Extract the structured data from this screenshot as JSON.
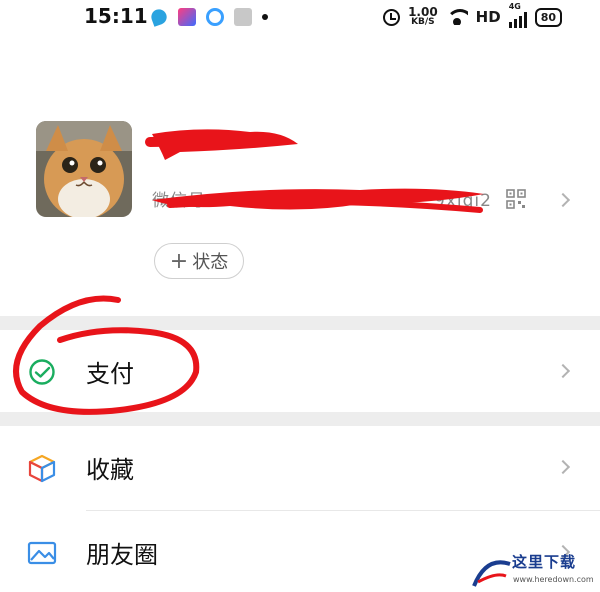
{
  "status_bar": {
    "time": "15:11",
    "net_speed_value": "1.00",
    "net_speed_unit": "KB/S",
    "network_type": "HD",
    "signal_label": "4G",
    "battery": "80"
  },
  "profile": {
    "nickname": "",
    "wechat_id_label": "微信号：",
    "wechat_id_visible_tail": "9xiqi20",
    "status_button_label": "状态",
    "status_button_plus": "+"
  },
  "menu": {
    "pay_label": "支付",
    "favorites_label": "收藏",
    "moments_label": "朋友圈"
  },
  "colors": {
    "pay_green": "#1aad5f",
    "annotation_red": "#e8141a",
    "divider_gray": "#ededed"
  },
  "watermark": {
    "name": "这里下载",
    "url": "www.heredown.com"
  }
}
